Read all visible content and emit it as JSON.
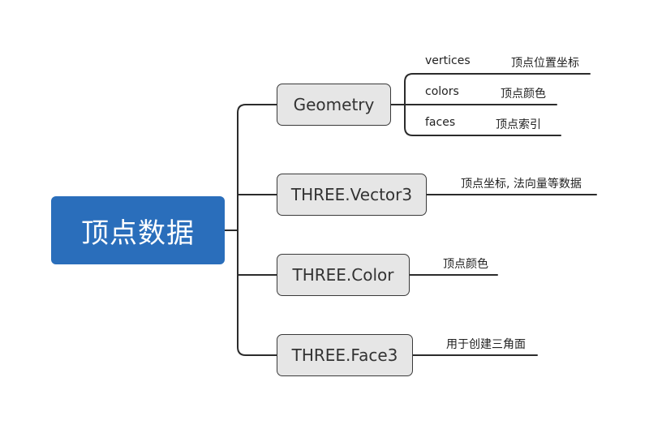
{
  "root": {
    "title": "顶点数据"
  },
  "branches": [
    {
      "title": "Geometry",
      "children": [
        {
          "name": "vertices",
          "desc": "顶点位置坐标"
        },
        {
          "name": "colors",
          "desc": "顶点颜色"
        },
        {
          "name": "faces",
          "desc": "顶点索引"
        }
      ]
    },
    {
      "title": "THREE.Vector3",
      "note": "顶点坐标, 法向量等数据"
    },
    {
      "title": "THREE.Color",
      "note": "顶点颜色"
    },
    {
      "title": "THREE.Face3",
      "note": "用于创建三角面"
    }
  ],
  "colors": {
    "root_fill": "#2a6ebb",
    "node_fill": "#e6e6e6",
    "line": "#2b2b2b"
  }
}
